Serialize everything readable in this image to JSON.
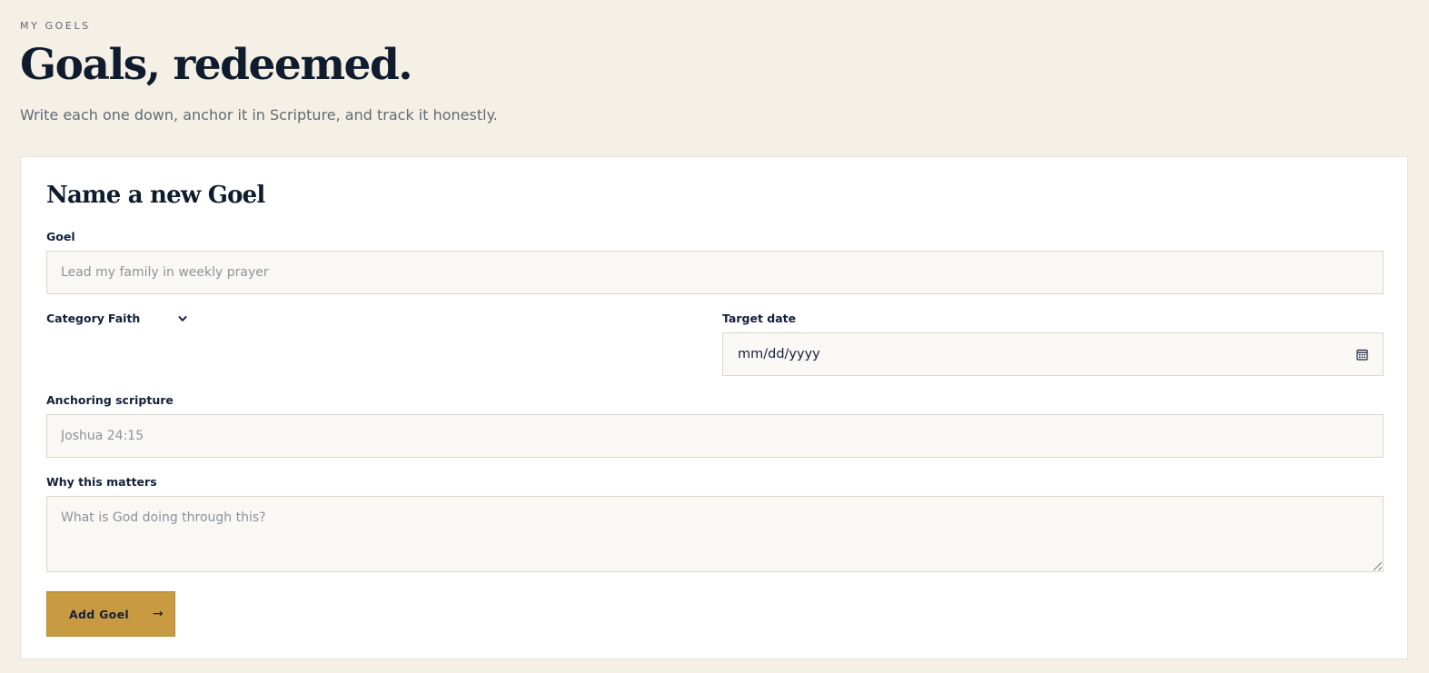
{
  "header": {
    "eyebrow": "MY GOELS",
    "title": "Goals, redeemed.",
    "subtitle": "Write each one down, anchor it in Scripture, and track it honestly."
  },
  "form": {
    "title": "Name a new Goel",
    "goel": {
      "label": "Goel",
      "placeholder": "Lead my family in weekly prayer",
      "value": ""
    },
    "category": {
      "label": "Category",
      "selected": "Faith",
      "icon": "chevron-down-icon"
    },
    "target_date": {
      "label": "Target date",
      "value": "mm/dd/yyyy",
      "icon": "calendar-icon"
    },
    "scripture": {
      "label": "Anchoring scripture",
      "placeholder": "Joshua 24:15",
      "value": ""
    },
    "why": {
      "label": "Why this matters",
      "placeholder": "What is God doing through this?",
      "value": ""
    },
    "submit": {
      "label": "Add Goel",
      "icon": "arrow-right-icon",
      "arrow": "→"
    }
  },
  "colors": {
    "background": "#f5f0e6",
    "card": "#ffffff",
    "navy": "#14213a",
    "accent": "#c89a42",
    "field_bg": "#faf8f4",
    "field_border": "#dcd8cf"
  }
}
